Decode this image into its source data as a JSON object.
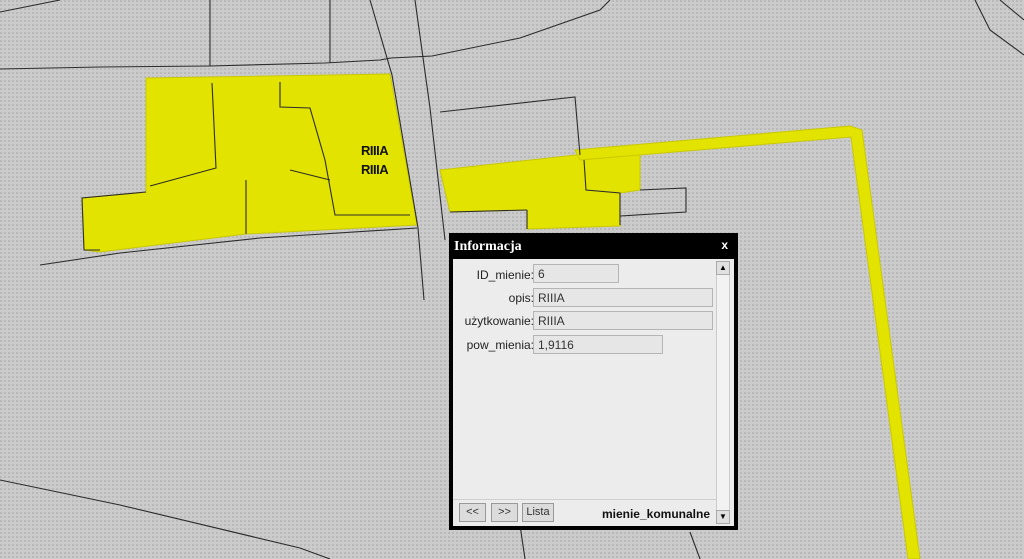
{
  "map": {
    "parcel_labels": [
      "RIIIA",
      "RIIIA"
    ],
    "highlight_color": "#e6e600",
    "line_color": "#333333"
  },
  "info_window": {
    "title": "Informacja",
    "close_label": "x",
    "fields": [
      {
        "label": "ID_mienie:",
        "value": "6"
      },
      {
        "label": "opis:",
        "value": "RIIIA"
      },
      {
        "label": "użytkowanie:",
        "value": "RIIIA"
      },
      {
        "label": "pow_mienia:",
        "value": "1,9116"
      }
    ],
    "prev_label": "<<",
    "next_label": ">>",
    "list_label": "Lista",
    "layer_name": "mienie_komunalne"
  }
}
